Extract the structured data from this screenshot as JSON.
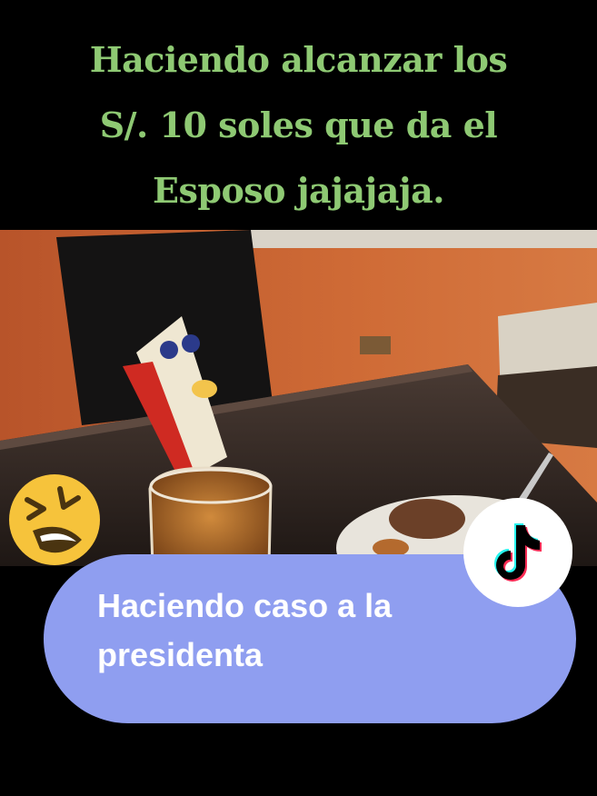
{
  "overlay": {
    "top_caption_lines": [
      "Haciendo alcanzar los",
      "S/. 10 soles que da el",
      "Esposo jajajaja."
    ],
    "bubble_text": "Haciendo caso a la presidenta"
  },
  "icons": {
    "laughing_emoji": "laughing-squinting-face-icon",
    "tiktok": "tiktok-logo-icon"
  },
  "colors": {
    "caption_green": "#8ec973",
    "bubble_blue": "#8f9ef0",
    "wall_orange": "#c86432"
  }
}
